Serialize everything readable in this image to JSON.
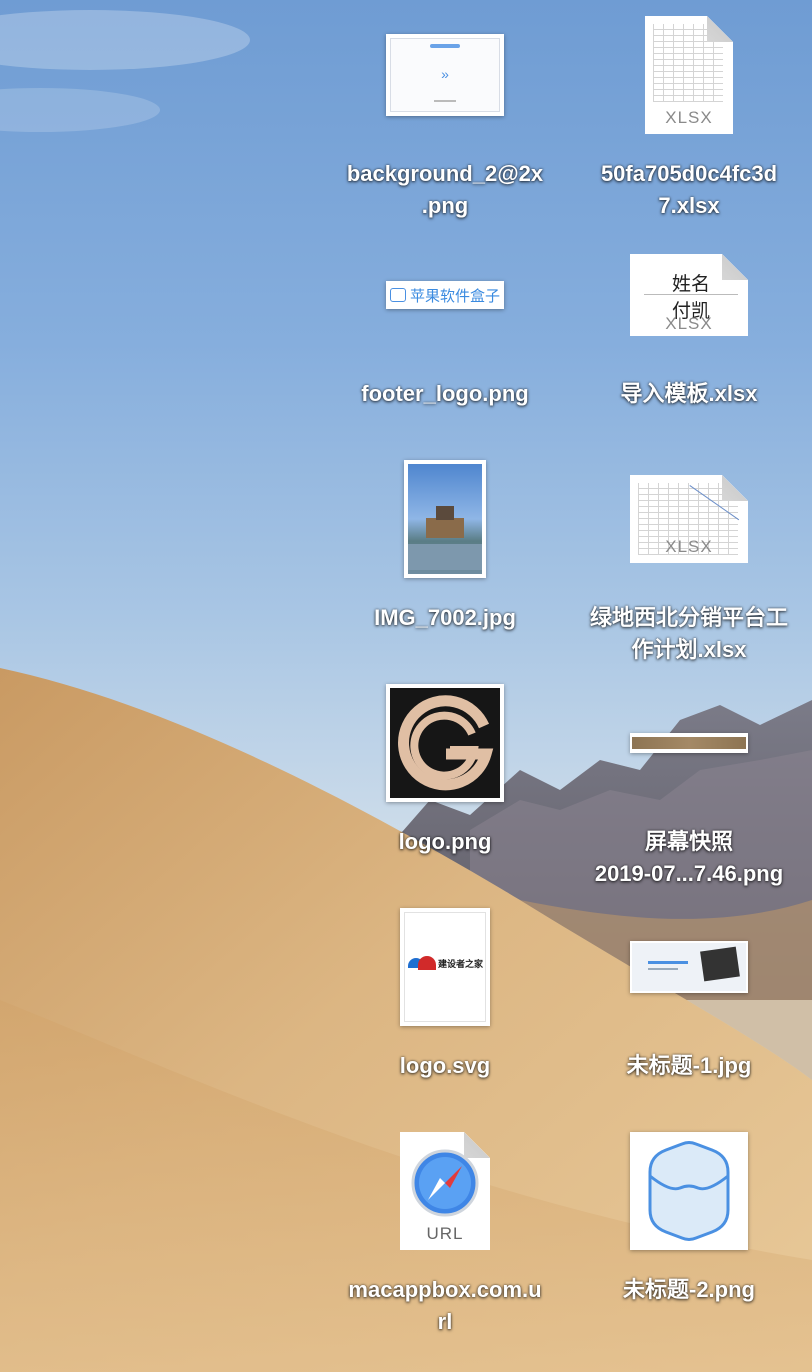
{
  "desktop": {
    "files": [
      {
        "name": "background_2@2x\n.png",
        "type": "png-thumbnail"
      },
      {
        "name": "50fa705d0c4fc3d\n7.xlsx",
        "type": "xlsx-document",
        "ext": "XLSX"
      },
      {
        "name": "footer_logo.png",
        "type": "png-thumbnail"
      },
      {
        "name": "导入模板.xlsx",
        "type": "xlsx-document",
        "ext": "XLSX",
        "cells": [
          "姓名",
          "付凯"
        ]
      },
      {
        "name": "IMG_7002.jpg",
        "type": "jpg-thumbnail"
      },
      {
        "name": "绿地西北分销平台工\n作计划.xlsx",
        "type": "xlsx-document",
        "ext": "XLSX"
      },
      {
        "name": "logo.png",
        "type": "png-thumbnail"
      },
      {
        "name": "屏幕快照\n2019-07...7.46.png",
        "type": "png-thumbnail"
      },
      {
        "name": "logo.svg",
        "type": "svg-thumbnail"
      },
      {
        "name": "未标题-1.jpg",
        "type": "jpg-thumbnail"
      },
      {
        "name": "macappbox.com.u\nrl",
        "type": "url-document",
        "ext": "URL"
      },
      {
        "name": "未标题-2.png",
        "type": "png-thumbnail"
      }
    ],
    "thumbnails": {
      "footer_logo_text": "苹果软件盒子",
      "logo_svg_text": "建设者之家"
    }
  },
  "colors": {
    "label_text": "#ffffff",
    "sky": "#7fa8dc",
    "sand": "#d7b07a",
    "mountain": "#6e6872"
  }
}
